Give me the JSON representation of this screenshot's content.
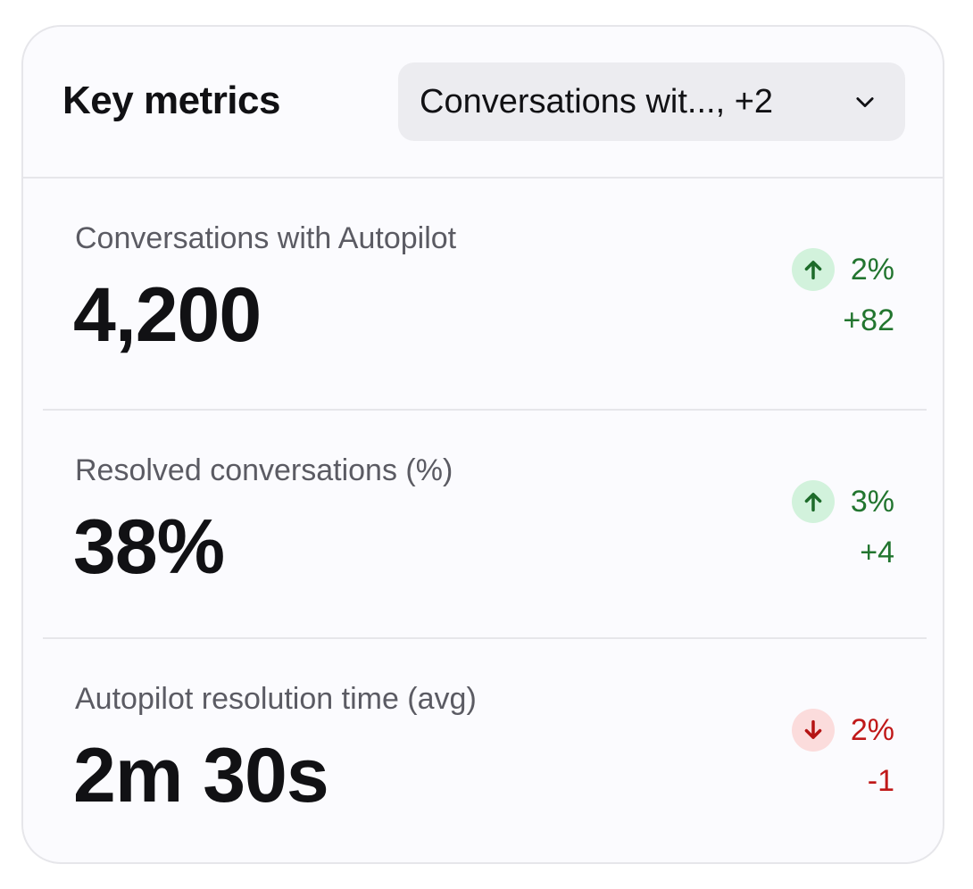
{
  "header": {
    "title": "Key metrics",
    "selector": {
      "label": "Conversations wit..., +2",
      "icon": "chevron-down-icon"
    }
  },
  "metrics": [
    {
      "label": "Conversations with Autopilot",
      "value": "4,200",
      "trend": "up",
      "trend_icon": "arrow-up-icon",
      "change_pct": "2%",
      "change_abs": "+82"
    },
    {
      "label": "Resolved conversations (%)",
      "value": "38%",
      "trend": "up",
      "trend_icon": "arrow-up-icon",
      "change_pct": "3%",
      "change_abs": "+4"
    },
    {
      "label": "Autopilot resolution time (avg)",
      "value": "2m 30s",
      "trend": "down",
      "trend_icon": "arrow-down-icon",
      "change_pct": "2%",
      "change_abs": "-1"
    }
  ],
  "colors": {
    "positive": "#22752f",
    "positive_bg": "#d2f2dc",
    "negative": "#c01818",
    "negative_bg": "#fbdcdc"
  }
}
